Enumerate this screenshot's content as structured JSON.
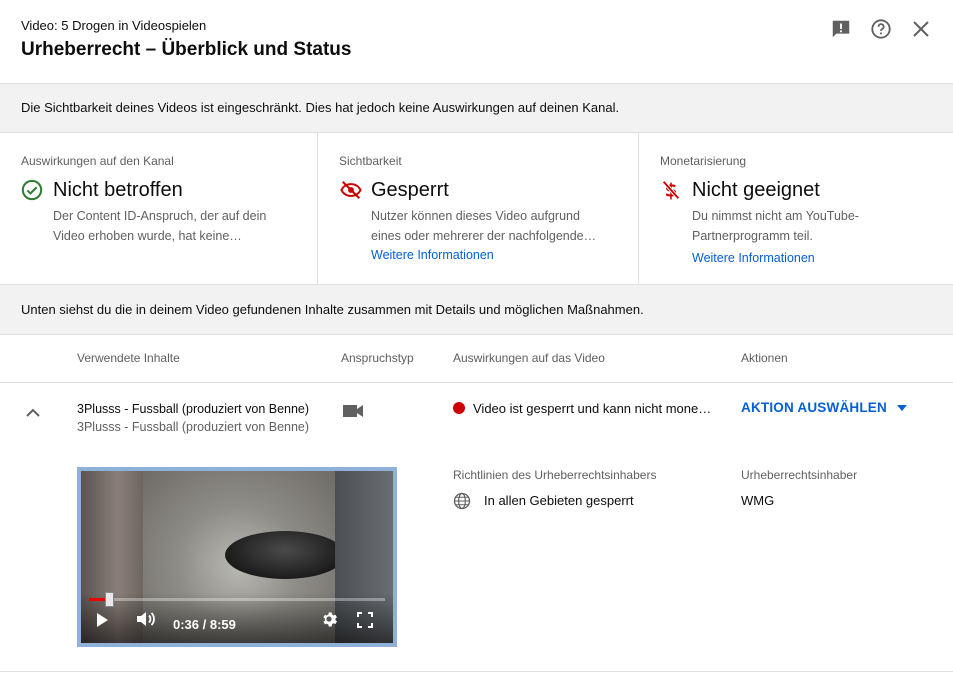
{
  "header": {
    "video_label": "Video: 5 Drogen in Videospielen",
    "title": "Urheberrecht – Überblick und Status"
  },
  "banner": {
    "text": "Die Sichtbarkeit deines Videos ist eingeschränkt. Dies hat jedoch keine Auswirkungen auf deinen Kanal."
  },
  "status": {
    "channel": {
      "label": "Auswirkungen auf den Kanal",
      "status": "Nicht betroffen",
      "desc_line1": "Der Content ID-Anspruch, der auf dein",
      "desc_line2": "Video erhoben wurde, hat keine…",
      "icon": "check-circle-icon",
      "color": "#2e7d32"
    },
    "visibility": {
      "label": "Sichtbarkeit",
      "status": "Gesperrt",
      "desc_line1": "Nutzer können dieses Video aufgrund",
      "desc_line2": "eines oder mehrerer der nachfolgenden…",
      "link": "Weitere Informationen",
      "icon": "eye-off-icon",
      "color": "#cc0000"
    },
    "monetization": {
      "label": "Monetarisierung",
      "status": "Nicht geeignet",
      "desc_line1": "Du nimmst nicht am YouTube-",
      "desc_line2": "Partnerprogramm teil.",
      "link": "Weitere Informationen",
      "icon": "money-off-icon",
      "color": "#cc0000"
    }
  },
  "banner2": {
    "text": "Unten siehst du die in deinem Video gefundenen Inhalte zusammen mit Details und möglichen Maßnahmen."
  },
  "table": {
    "headers": {
      "content": "Verwendete Inhalte",
      "claim_type": "Anspruchstyp",
      "impact": "Auswirkungen auf das Video",
      "actions": "Aktionen"
    },
    "row": {
      "title": "3Plusss - Fussball (produziert von Benne)",
      "subtitle": "3Plusss - Fussball (produziert von Benne)",
      "claim_icon": "video-camera-icon",
      "impact": "Video ist gesperrt und kann nicht monetarisiert werden",
      "action": "AKTION AUSWÄHLEN",
      "policy_label": "Richtlinien des Urheberrechtsinhabers",
      "policy": "In allen Gebieten gesperrt",
      "owner_label": "Urheberrechtsinhaber",
      "owner": "WMG"
    }
  },
  "player": {
    "time": "0:36 / 8:59",
    "progress": 0.067
  },
  "colors": {
    "link": "#065fd4",
    "alert": "#cc0000"
  }
}
